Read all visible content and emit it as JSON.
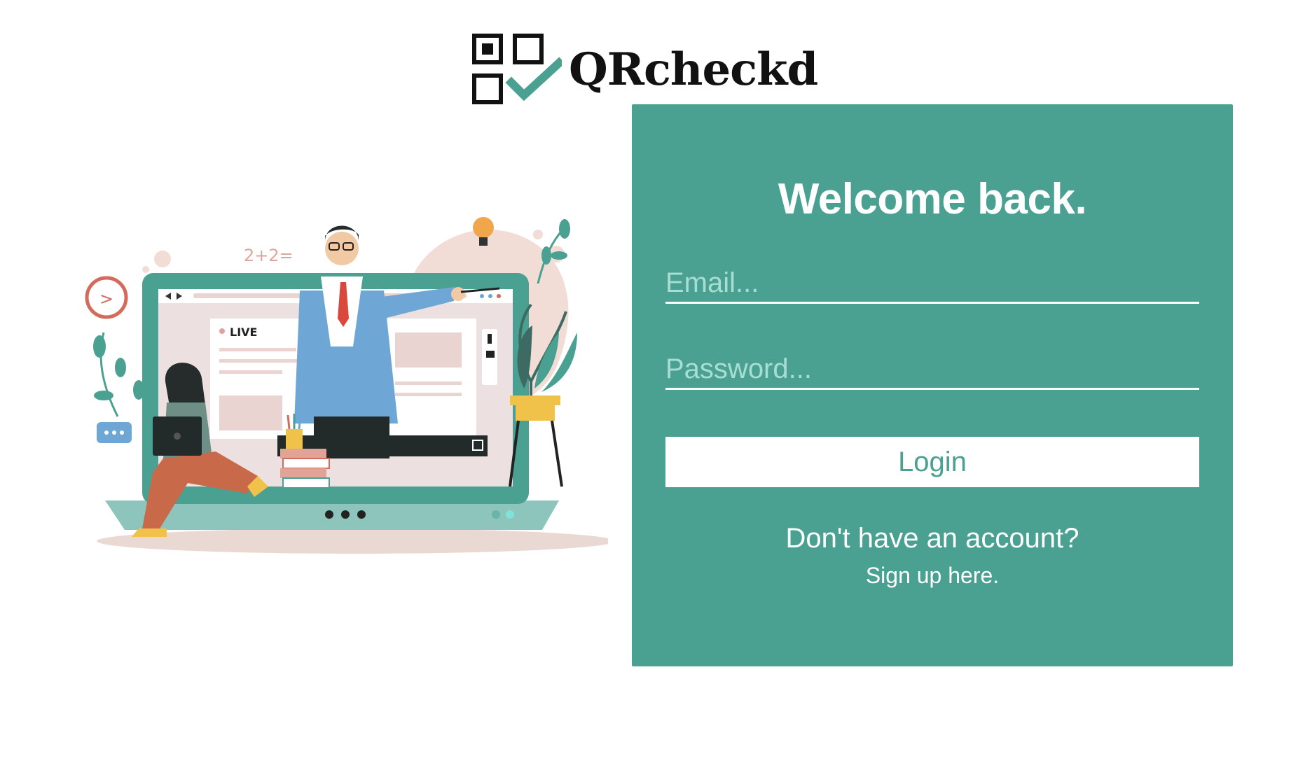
{
  "brand": {
    "name": "QRcheckd",
    "logo_icon": "qr-checklist-icon",
    "accent_color": "#4aa091"
  },
  "illustration": {
    "icon": "online-class-illustration",
    "live_badge": "LIVE",
    "math_text": "2+2="
  },
  "login": {
    "title": "Welcome back.",
    "email_placeholder": "Email...",
    "password_placeholder": "Password...",
    "email_value": "",
    "password_value": "",
    "submit_label": "Login",
    "no_account_text": "Don't have an account?",
    "signup_link_text": "Sign up here."
  }
}
